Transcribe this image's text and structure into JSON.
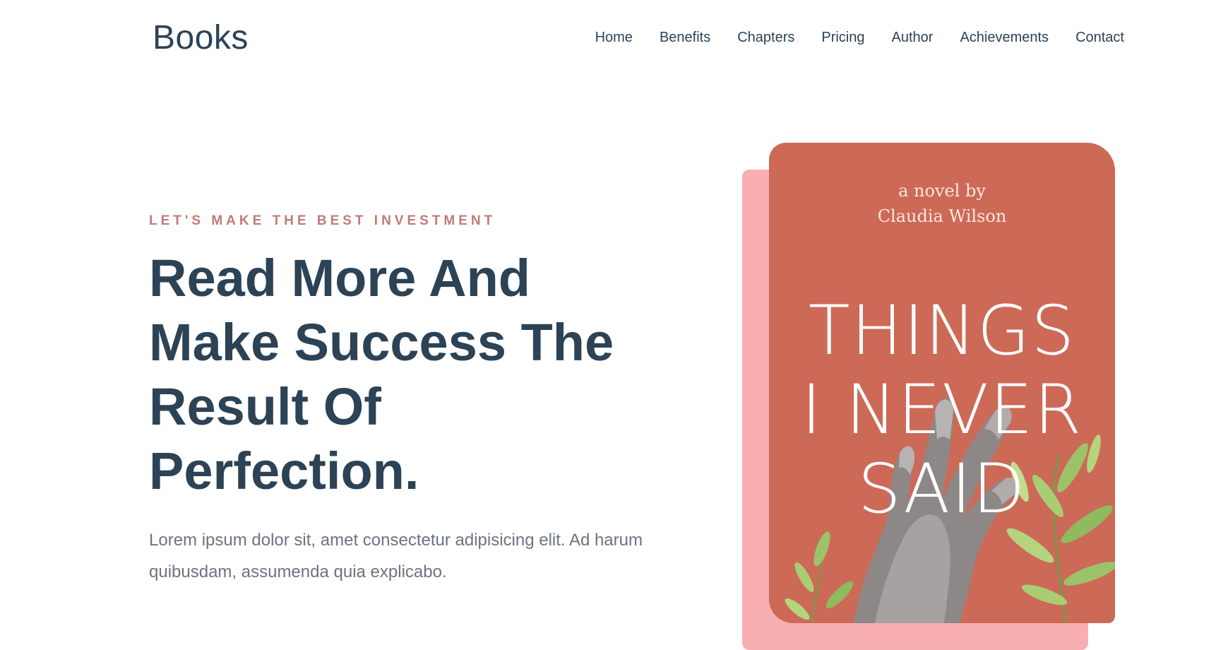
{
  "header": {
    "brand": "Books",
    "nav": [
      {
        "label": "Home"
      },
      {
        "label": "Benefits"
      },
      {
        "label": "Chapters"
      },
      {
        "label": "Pricing"
      },
      {
        "label": "Author"
      },
      {
        "label": "Achievements"
      },
      {
        "label": "Contact"
      }
    ]
  },
  "hero": {
    "eyebrow": "LET'S MAKE THE BEST INVESTMENT",
    "title_lines": [
      "Read More And",
      "Make Success The",
      "Result Of",
      "Perfection."
    ],
    "description": "Lorem ipsum dolor sit, amet consectetur adipisicing elit. Ad harum quibusdam, assumenda quia explicabo."
  },
  "book": {
    "byline_line1": "a novel by",
    "byline_line2": "Claudia Wilson",
    "title_line1": "THINGS",
    "title_line2": "I NEVER",
    "title_line3": "SAID",
    "colors": {
      "cover": "#cd6957",
      "shadow": "#f9aeb2"
    },
    "art_icons": [
      "hand-illustration-icon",
      "leaf-branch-icon"
    ]
  },
  "colors": {
    "primary_text": "#2c4356",
    "accent": "#c17a7a",
    "body_text": "#6b7480"
  }
}
